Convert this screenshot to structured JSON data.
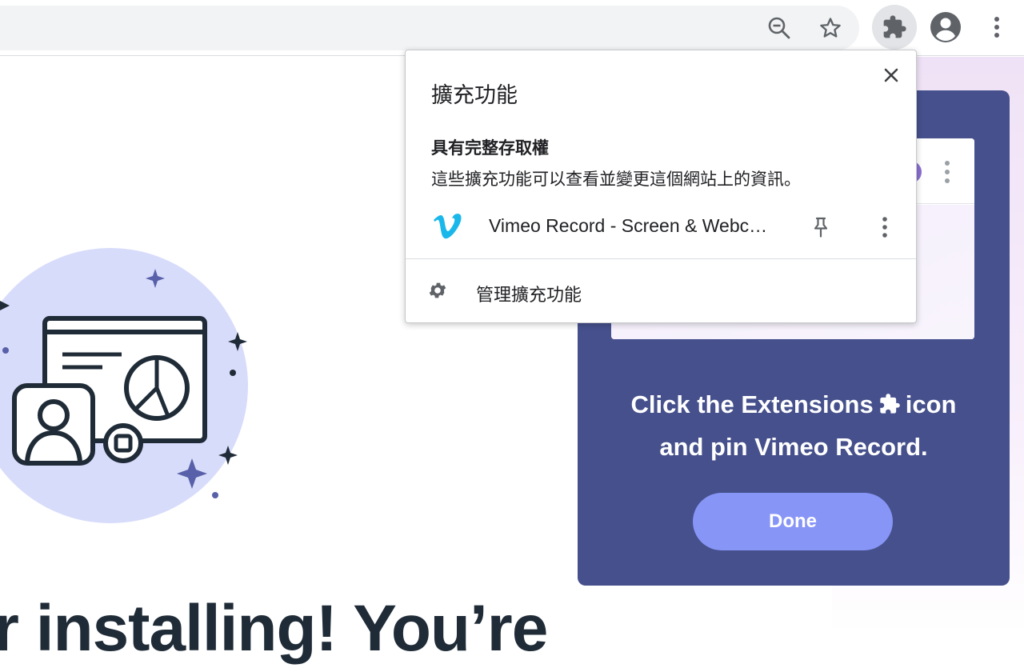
{
  "toolbar": {
    "icons": [
      "zoom-out-icon",
      "bookmark-star-icon",
      "extensions-puzzle-icon",
      "profile-avatar-icon",
      "browser-menu-icon"
    ]
  },
  "extensions_popup": {
    "title": "擴充功能",
    "close_icon": "close-icon",
    "section_heading": "具有完整存取權",
    "section_description": "這些擴充功能可以查看並變更這個網站上的資訊。",
    "extensions": [
      {
        "name": "Vimeo Record - Screen & Webcam Recorder",
        "icon": "vimeo-logo-icon",
        "pin_icon": "pin-icon",
        "more_icon": "more-vert-icon"
      }
    ],
    "manage_label": "管理擴充功能",
    "manage_icon": "gear-icon"
  },
  "page": {
    "headline": "r installing! You’re",
    "instruction_line1_before": "Click the Extensions",
    "instruction_line1_after": "icon",
    "instruction_line2": "and pin Vimeo Record.",
    "done_label": "Done"
  },
  "colors": {
    "card_bg": "#45508c",
    "done_bg": "#8795f6",
    "illustration_circle": "#d8dcfb",
    "vimeo_blue": "#1ab7ea",
    "headline": "#1f2b37"
  }
}
